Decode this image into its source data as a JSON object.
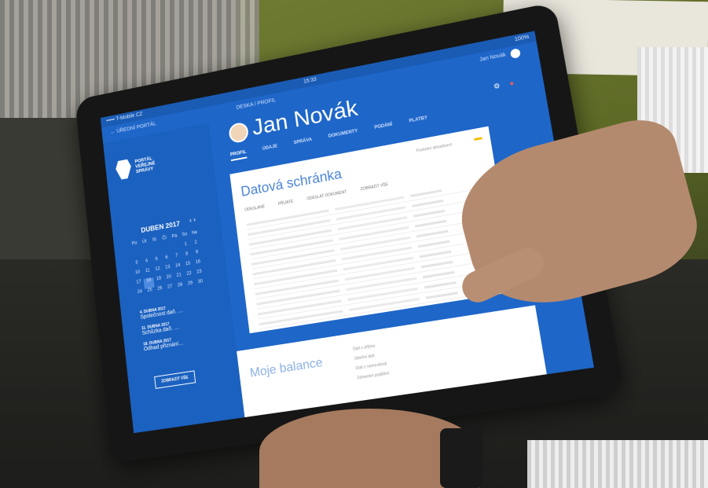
{
  "status": {
    "carrier": "••••• T-Mobile CZ",
    "time": "15:33",
    "battery": "100%"
  },
  "topbar": {
    "back": "← ÚŘEDNÍ PORTÁL",
    "breadcrumb": "DESKA / PROFIL",
    "user": "Jan Novák"
  },
  "logo": {
    "line1": "PORTÁL",
    "line2": "VEŘEJNÉ",
    "line3": "SPRÁVY"
  },
  "calendar": {
    "title": "DUBEN 2017",
    "prev": "‹",
    "next": "›",
    "days": [
      "Po",
      "Út",
      "St",
      "Čt",
      "Pá",
      "So",
      "Ne",
      "",
      "",
      "",
      "",
      "",
      "1",
      "2",
      "3",
      "4",
      "5",
      "6",
      "7",
      "8",
      "9",
      "10",
      "11",
      "12",
      "13",
      "14",
      "15",
      "16",
      "17",
      "18",
      "19",
      "20",
      "21",
      "22",
      "23",
      "24",
      "25",
      "26",
      "27",
      "28",
      "29",
      "30"
    ]
  },
  "events": [
    {
      "date": "4. DUBNA 2017",
      "text": "Společnost daň. …"
    },
    {
      "date": "11. DUBNA 2017",
      "text": "Schůzka daň. …"
    },
    {
      "date": "18. DUBNA 2017",
      "text": "Odhad přiznání…"
    }
  ],
  "sidebar_button": "ZOBRAZIT VŠE",
  "header": {
    "name": "Jan Novák",
    "nav": [
      "PROFIL",
      "ÚDAJE",
      "SPRÁVA",
      "DOKUMENTY",
      "PODÁNÍ",
      "PLATBY"
    ],
    "icons": [
      "gear-icon",
      "notification-icon"
    ]
  },
  "card1": {
    "title": "Datová schránka",
    "filters": [
      "ODESLANÉ",
      "PŘIJATÉ",
      "ODESLAT DOKUMENT",
      "ZOBRAZIT VŠE"
    ],
    "top_right": "Poslední aktualizace"
  },
  "card2": {
    "title": "Moje balance",
    "lines": [
      "Daň z příjmu",
      "Silniční daň",
      "Daň z nemovitosti",
      "Zdravotní pojištění"
    ]
  }
}
